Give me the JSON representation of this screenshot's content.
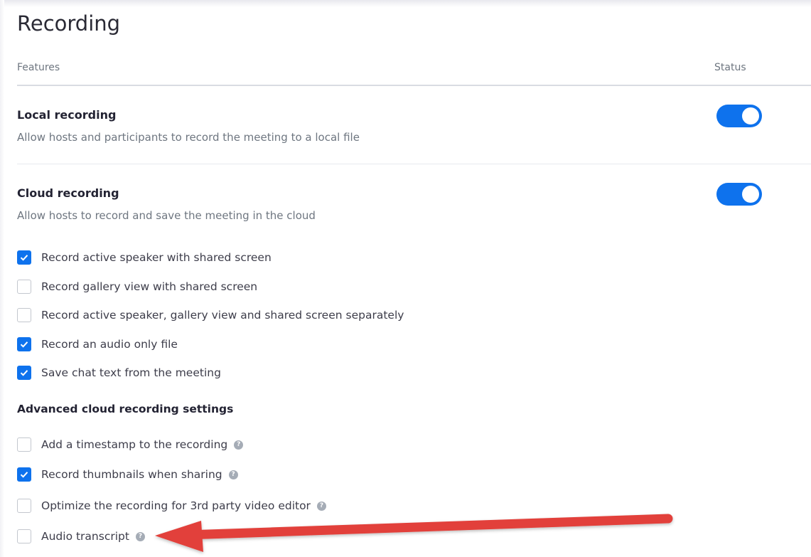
{
  "page": {
    "title": "Recording"
  },
  "table_header": {
    "features": "Features",
    "status": "Status"
  },
  "features": [
    {
      "title": "Local recording",
      "description": "Allow hosts and participants to record the meeting to a local file",
      "enabled": true
    },
    {
      "title": "Cloud recording",
      "description": "Allow hosts to record and save the meeting in the cloud",
      "enabled": true
    }
  ],
  "cloud_options": [
    {
      "label": "Record active speaker with shared screen",
      "checked": true
    },
    {
      "label": "Record gallery view with shared screen",
      "checked": false
    },
    {
      "label": "Record active speaker, gallery view and shared screen separately",
      "checked": false
    },
    {
      "label": "Record an audio only file",
      "checked": true
    },
    {
      "label": "Save chat text from the meeting",
      "checked": true
    }
  ],
  "advanced": {
    "heading": "Advanced cloud recording settings",
    "options": [
      {
        "label": "Add a timestamp to the recording",
        "checked": false,
        "help": "?"
      },
      {
        "label": "Record thumbnails when sharing",
        "checked": true,
        "help": "?"
      },
      {
        "label": "Optimize the recording for 3rd party video editor",
        "checked": false,
        "help": "?"
      },
      {
        "label": "Audio transcript",
        "checked": false,
        "help": "?"
      }
    ]
  },
  "colors": {
    "accent": "#0e72ed",
    "annotation_arrow": "#e2413a"
  },
  "icons": {
    "checkmark": "check-icon",
    "help": "question-circle-icon",
    "annotation": "red-arrow"
  }
}
